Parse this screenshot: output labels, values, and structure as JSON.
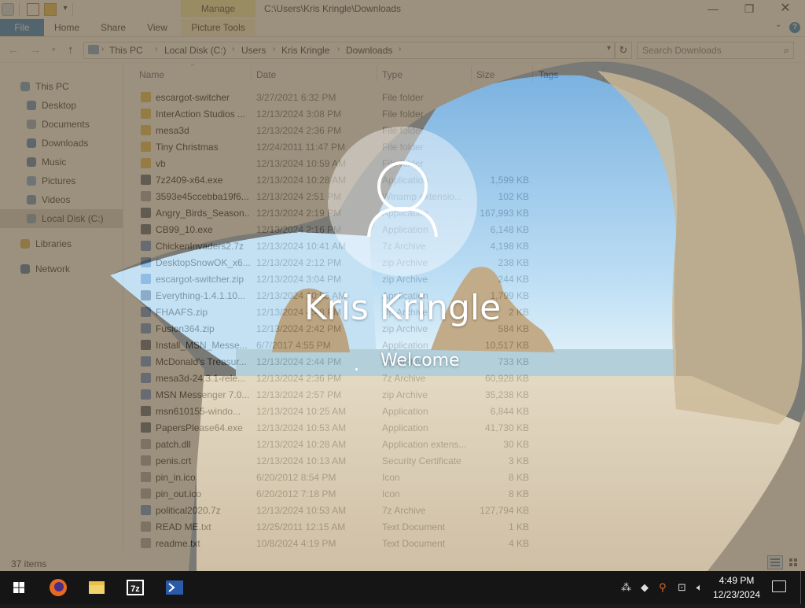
{
  "window": {
    "title": "C:\\Users\\Kris Kringle\\Downloads",
    "contextual_tab": "Manage",
    "controls": {
      "minimize": "—",
      "maximize": "❐",
      "close": "✕"
    }
  },
  "ribbon": {
    "tabs": [
      {
        "label": "File"
      },
      {
        "label": "Home"
      },
      {
        "label": "Share"
      },
      {
        "label": "View"
      },
      {
        "label": "Picture Tools"
      }
    ],
    "help": "?"
  },
  "address": {
    "crumbs": [
      "This PC",
      "Local Disk (C:)",
      "Users",
      "Kris Kringle",
      "Downloads"
    ],
    "search_placeholder": "Search Downloads"
  },
  "nav": {
    "items": [
      {
        "label": "This PC",
        "icon": "computer-icon"
      },
      {
        "label": "Desktop",
        "icon": "desktop-icon"
      },
      {
        "label": "Documents",
        "icon": "documents-icon"
      },
      {
        "label": "Downloads",
        "icon": "downloads-icon"
      },
      {
        "label": "Music",
        "icon": "music-icon"
      },
      {
        "label": "Pictures",
        "icon": "pictures-icon"
      },
      {
        "label": "Videos",
        "icon": "videos-icon"
      },
      {
        "label": "Local Disk (C:)",
        "icon": "drive-icon",
        "selected": true
      },
      {
        "label": "Libraries",
        "icon": "libraries-icon"
      },
      {
        "label": "Network",
        "icon": "network-icon"
      }
    ]
  },
  "columns": {
    "name": "Name",
    "date": "Date",
    "type": "Type",
    "size": "Size",
    "tags": "Tags"
  },
  "files": [
    {
      "name": "escargot-switcher",
      "date": "3/27/2021 6:32 PM",
      "type": "File folder",
      "size": "",
      "icon": "folder"
    },
    {
      "name": "InterAction Studios ...",
      "date": "12/13/2024 3:08 PM",
      "type": "File folder",
      "size": "",
      "icon": "folder"
    },
    {
      "name": "mesa3d",
      "date": "12/13/2024 2:36 PM",
      "type": "File folder",
      "size": "",
      "icon": "folder"
    },
    {
      "name": "Tiny Christmas",
      "date": "12/24/2011 11:47 PM",
      "type": "File folder",
      "size": "",
      "icon": "folder"
    },
    {
      "name": "vb",
      "date": "12/13/2024 10:59 AM",
      "type": "File folder",
      "size": "",
      "icon": "folder"
    },
    {
      "name": "7z2409-x64.exe",
      "date": "12/13/2024 10:28 AM",
      "type": "Application",
      "size": "1,599 KB",
      "icon": "app"
    },
    {
      "name": "3593e45ccebba19f6...",
      "date": "12/13/2024 2:51 PM",
      "type": "Winamp extensio...",
      "size": "102 KB",
      "icon": "doc"
    },
    {
      "name": "Angry_Birds_Season...",
      "date": "12/13/2024 2:19 PM",
      "type": "Application",
      "size": "167,993 KB",
      "icon": "app"
    },
    {
      "name": "CB99_10.exe",
      "date": "12/13/2024 2:16 PM",
      "type": "Application",
      "size": "6,148 KB",
      "icon": "app"
    },
    {
      "name": "ChickenInvaders2.7z",
      "date": "12/13/2024 10:41 AM",
      "type": "7z Archive",
      "size": "4,198 KB",
      "icon": "archive"
    },
    {
      "name": "DesktopSnowOK_x6...",
      "date": "12/13/2024 2:12 PM",
      "type": "zip Archive",
      "size": "238 KB",
      "icon": "archive"
    },
    {
      "name": "escargot-switcher.zip",
      "date": "12/13/2024 3:04 PM",
      "type": "zip Archive",
      "size": "244 KB",
      "icon": "archive"
    },
    {
      "name": "Everything-1.4.1.10...",
      "date": "12/13/2024 10:55 AM",
      "type": "Application",
      "size": "1,799 KB",
      "icon": "app"
    },
    {
      "name": "FHAAFS.zip",
      "date": "12/13/2024 4:48 PM",
      "type": "zip Archive",
      "size": "2 KB",
      "icon": "archive"
    },
    {
      "name": "Fusion364.zip",
      "date": "12/13/2024 2:42 PM",
      "type": "zip Archive",
      "size": "584 KB",
      "icon": "archive"
    },
    {
      "name": "Install_MSN_Messe...",
      "date": "6/7/2017 4:55 PM",
      "type": "Application",
      "size": "10,517 KB",
      "icon": "app"
    },
    {
      "name": "McDonald's Treasur...",
      "date": "12/13/2024 2:44 PM",
      "type": "zip Archive",
      "size": "733 KB",
      "icon": "archive"
    },
    {
      "name": "mesa3d-24.3.1-rele...",
      "date": "12/13/2024 2:36 PM",
      "type": "7z Archive",
      "size": "60,928 KB",
      "icon": "archive"
    },
    {
      "name": "MSN Messenger 7.0...",
      "date": "12/13/2024 2:57 PM",
      "type": "zip Archive",
      "size": "35,238 KB",
      "icon": "archive"
    },
    {
      "name": "msn610155-windo...",
      "date": "12/13/2024 10:25 AM",
      "type": "Application",
      "size": "6,844 KB",
      "icon": "app"
    },
    {
      "name": "PapersPlease64.exe",
      "date": "12/13/2024 10:53 AM",
      "type": "Application",
      "size": "41,730 KB",
      "icon": "app"
    },
    {
      "name": "patch.dll",
      "date": "12/13/2024 10:28 AM",
      "type": "Application extens...",
      "size": "30 KB",
      "icon": "doc"
    },
    {
      "name": "penis.crt",
      "date": "12/13/2024 10:13 AM",
      "type": "Security Certificate",
      "size": "3 KB",
      "icon": "doc"
    },
    {
      "name": "pin_in.ico",
      "date": "6/20/2012 8:54 PM",
      "type": "Icon",
      "size": "8 KB",
      "icon": "doc"
    },
    {
      "name": "pin_out.ico",
      "date": "6/20/2012 7:18 PM",
      "type": "Icon",
      "size": "8 KB",
      "icon": "doc"
    },
    {
      "name": "political2020.7z",
      "date": "12/13/2024 10:53 AM",
      "type": "7z Archive",
      "size": "127,794 KB",
      "icon": "archive"
    },
    {
      "name": "READ ME.txt",
      "date": "12/25/2011 12:15 AM",
      "type": "Text Document",
      "size": "1 KB",
      "icon": "doc"
    },
    {
      "name": "readme.txt",
      "date": "10/8/2024 4:19 PM",
      "type": "Text Document",
      "size": "4 KB",
      "icon": "doc"
    }
  ],
  "status": {
    "item_count": "37 items"
  },
  "lock": {
    "user_name": "Kris Kringle",
    "welcome": "Welcome"
  },
  "taskbar": {
    "apps": [
      "windows-start-icon",
      "firefox-icon",
      "file-explorer-icon",
      "7zip-icon",
      "powershell-icon"
    ],
    "time": "4:49 PM",
    "date": "12/23/2024"
  },
  "colors": {
    "accent": "#1979ca",
    "folder": "#e8c04a",
    "archive": "#5b8fd6",
    "app": "#4a5a70",
    "doc": "#9aa4b0",
    "taskbar": "#151515"
  }
}
